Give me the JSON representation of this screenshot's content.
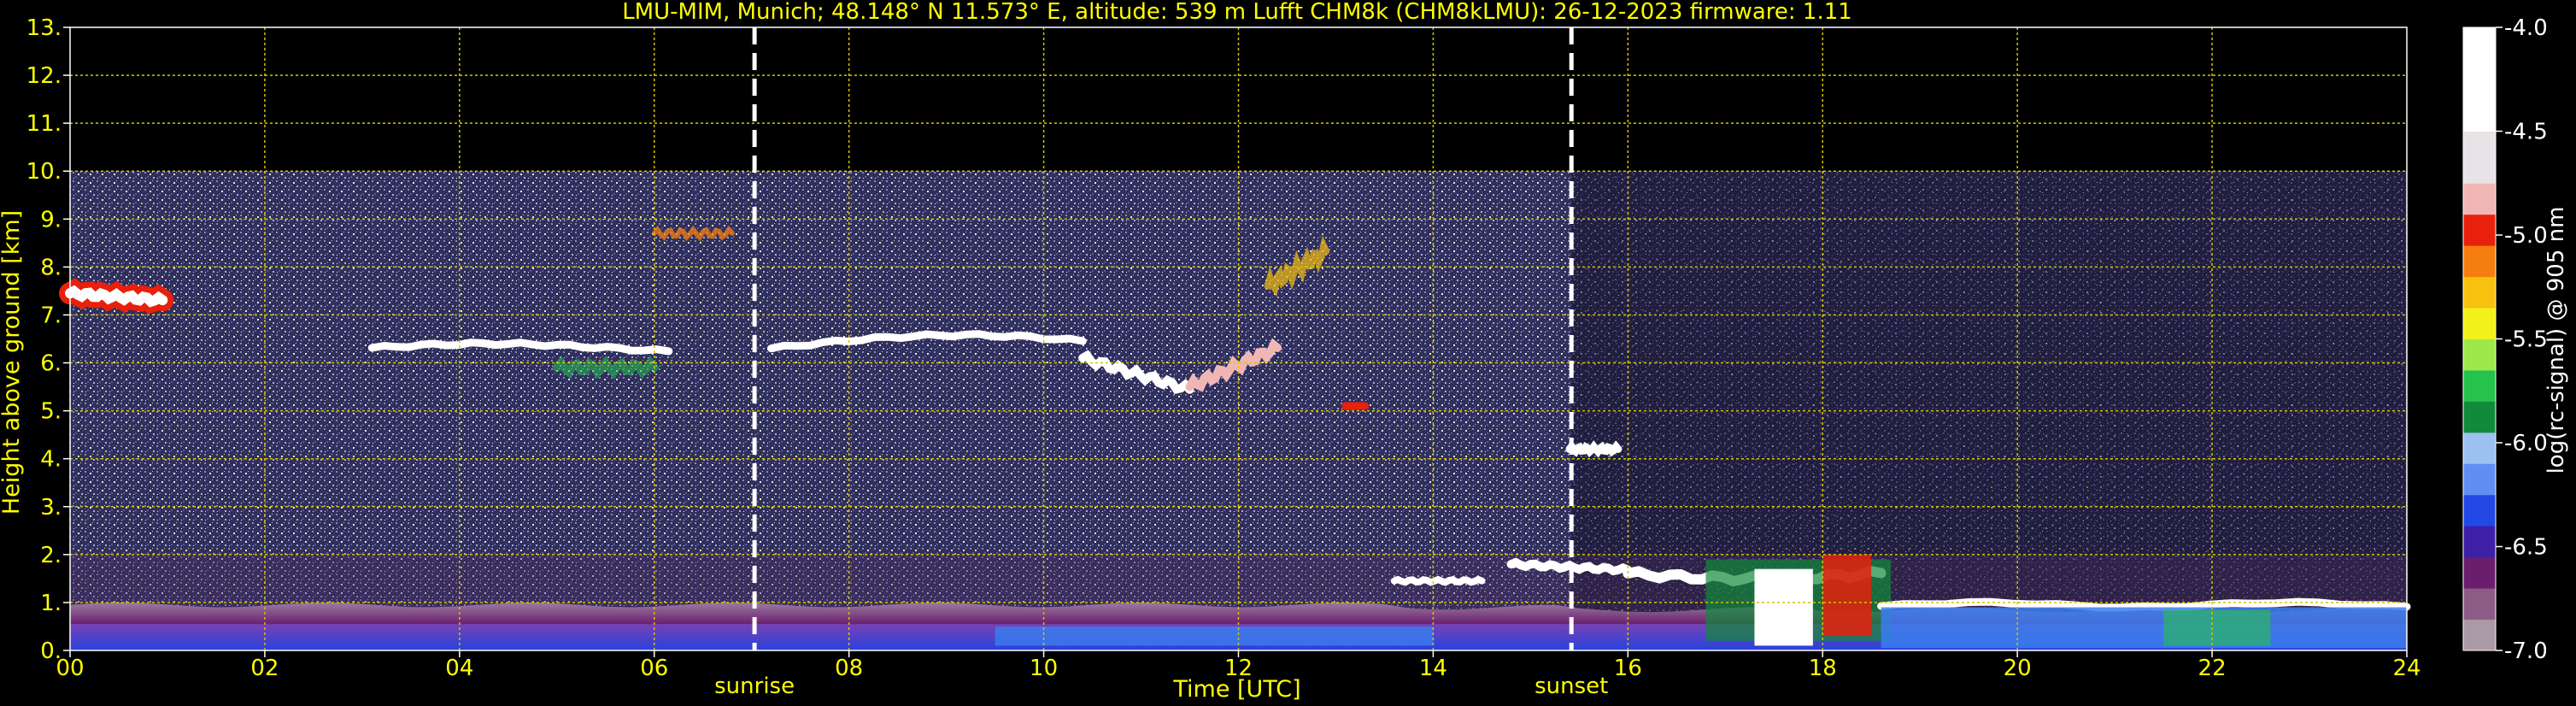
{
  "chart_data": {
    "type": "heatmap",
    "title": "LMU-MIM, Munich; 48.148° N 11.573° E, altitude: 539 m    Lufft CHM8k (CHM8kLMU): 26-12-2023    firmware: 1.11",
    "xlabel": "Time [UTC]",
    "ylabel": "Height above ground [km]",
    "colorbar_label": "log(rc-signal) @ 905 nm",
    "xlim": [
      0,
      24
    ],
    "ylim": [
      0,
      13
    ],
    "x_ticks": [
      {
        "value": 0,
        "label": "00"
      },
      {
        "value": 2,
        "label": "02"
      },
      {
        "value": 4,
        "label": "04"
      },
      {
        "value": 6,
        "label": "06"
      },
      {
        "value": 8,
        "label": "08"
      },
      {
        "value": 10,
        "label": "10"
      },
      {
        "value": 12,
        "label": "12"
      },
      {
        "value": 14,
        "label": "14"
      },
      {
        "value": 16,
        "label": "16"
      },
      {
        "value": 18,
        "label": "18"
      },
      {
        "value": 20,
        "label": "20"
      },
      {
        "value": 22,
        "label": "22"
      },
      {
        "value": 24,
        "label": "24"
      }
    ],
    "y_ticks": [
      {
        "value": 0,
        "label": "0."
      },
      {
        "value": 1,
        "label": "1."
      },
      {
        "value": 2,
        "label": "2."
      },
      {
        "value": 3,
        "label": "3."
      },
      {
        "value": 4,
        "label": "4."
      },
      {
        "value": 5,
        "label": "5."
      },
      {
        "value": 6,
        "label": "6."
      },
      {
        "value": 7,
        "label": "7."
      },
      {
        "value": 8,
        "label": "8."
      },
      {
        "value": 9,
        "label": "9."
      },
      {
        "value": 10,
        "label": "10."
      },
      {
        "value": 11,
        "label": "11."
      },
      {
        "value": 12,
        "label": "12."
      },
      {
        "value": 13,
        "label": "13."
      }
    ],
    "colorbar": {
      "range": [
        -7.0,
        -4.0
      ],
      "ticks": [
        {
          "value": -4.0,
          "label": "-4.0"
        },
        {
          "value": -4.5,
          "label": "-4.5"
        },
        {
          "value": -5.0,
          "label": "-5.0"
        },
        {
          "value": -5.5,
          "label": "-5.5"
        },
        {
          "value": -6.0,
          "label": "-6.0"
        },
        {
          "value": -6.5,
          "label": "-6.5"
        },
        {
          "value": -7.0,
          "label": "-7.0"
        }
      ],
      "stops": [
        {
          "value": -7.0,
          "color": "#a99aa6"
        },
        {
          "value": -6.85,
          "color": "#8c5c86"
        },
        {
          "value": -6.7,
          "color": "#6a1f6e"
        },
        {
          "value": -6.55,
          "color": "#3d1fa8"
        },
        {
          "value": -6.4,
          "color": "#2248e6"
        },
        {
          "value": -6.25,
          "color": "#5f8ff2"
        },
        {
          "value": -6.1,
          "color": "#9cc0f0"
        },
        {
          "value": -5.95,
          "color": "#118a3a"
        },
        {
          "value": -5.8,
          "color": "#25c24c"
        },
        {
          "value": -5.65,
          "color": "#9ee84a"
        },
        {
          "value": -5.5,
          "color": "#f2f21a"
        },
        {
          "value": -5.35,
          "color": "#f7c10e"
        },
        {
          "value": -5.2,
          "color": "#f57e0e"
        },
        {
          "value": -5.05,
          "color": "#e8200c"
        },
        {
          "value": -4.9,
          "color": "#f0b6b6"
        },
        {
          "value": -4.75,
          "color": "#e8e3e6"
        },
        {
          "value": -4.5,
          "color": "#ffffff"
        },
        {
          "value": -4.0,
          "color": "#ffffff"
        }
      ]
    },
    "measurement_top_km": 10,
    "annotations": [
      {
        "x": 7.03,
        "label": "sunrise"
      },
      {
        "x": 15.42,
        "label": "sunset"
      }
    ],
    "grid": true,
    "colors": {
      "text": "#ffff00",
      "grid": "#d4c400",
      "background": "#000000",
      "noise": "#2a2a52"
    }
  }
}
